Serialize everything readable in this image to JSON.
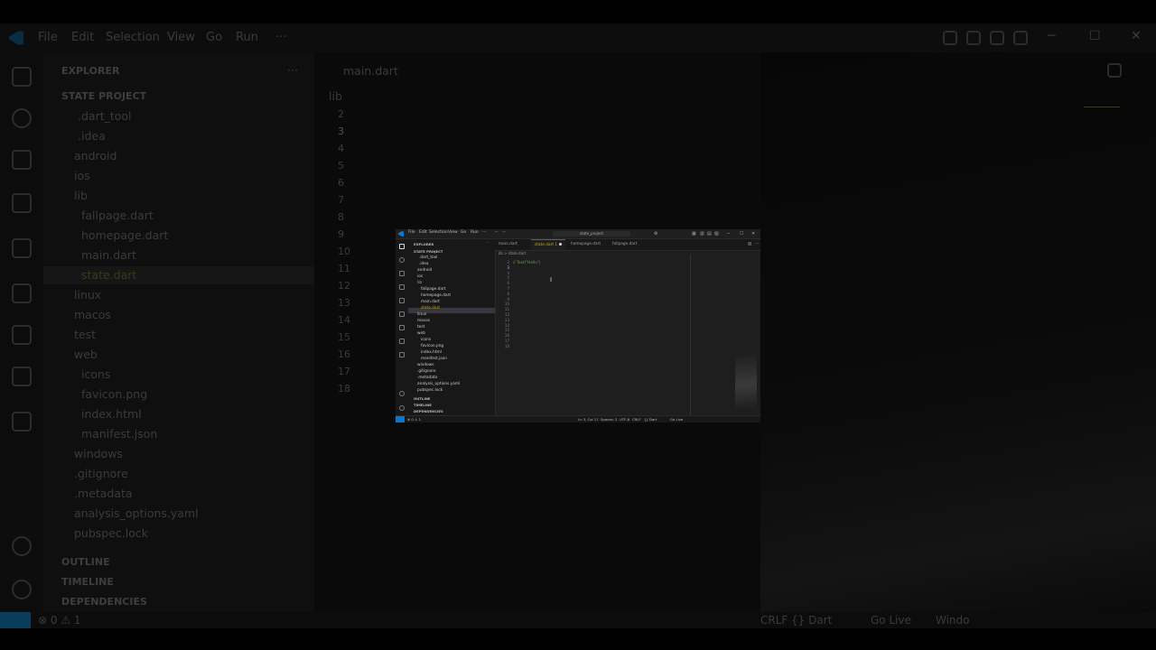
{
  "background": {
    "menu": [
      "File",
      "Edit",
      "Selection",
      "View",
      "Go",
      "Run",
      "···"
    ],
    "explorer_title": "EXPLORER",
    "project": "STATE PROJECT",
    "tree": [
      ".dart_tool",
      ".idea",
      "android",
      "ios",
      "lib",
      "fallpage.dart",
      "homepage.dart",
      "main.dart",
      "state.dart",
      "linux",
      "macos",
      "test",
      "web",
      "icons",
      "favicon.png",
      "index.html",
      "manifest.json",
      "windows",
      ".gitignore",
      ".metadata",
      "analysis_options.yaml",
      "pubspec.lock"
    ],
    "sections": [
      "OUTLINE",
      "TIMELINE",
      "DEPENDENCIES"
    ],
    "tab": "main.dart",
    "crumb": "lib",
    "line_numbers": [
      "2",
      "3",
      "4",
      "5",
      "6",
      "7",
      "8",
      "9",
      "10",
      "11",
      "12",
      "13",
      "14",
      "15",
      "16",
      "17",
      "18"
    ],
    "status_left": "⊗ 0 ⚠ 1",
    "status_right": [
      "CRLF",
      "{} Dart",
      "Go Live",
      "Windo"
    ]
  },
  "window": {
    "menu": [
      "File",
      "Edit",
      "Selection",
      "View",
      "Go",
      "Run",
      "···"
    ],
    "search": "state_project",
    "explorer_title": "EXPLORER",
    "project": "STATE PROJECT",
    "tree": [
      ".dart_tool",
      ".idea",
      "android",
      "ios",
      "lib",
      "fallpage.dart",
      "homepage.dart",
      "main.dart",
      "state.dart",
      "linux",
      "macos",
      "test",
      "web",
      "icons",
      "favicon.png",
      "index.html",
      "manifest.json",
      "windows",
      ".gitignore",
      ".metadata",
      "analysis_options.yaml",
      "pubspec.lock"
    ],
    "sections": [
      "OUTLINE",
      "TIMELINE",
      "DEPENDENCIES"
    ],
    "tabs": [
      "main.dart",
      "state.dart 1",
      "homepage.dart",
      "fallpage.dart"
    ],
    "crumb": "lib > state.dart",
    "line_numbers": [
      "2",
      "3",
      "4",
      "5",
      "6",
      "7",
      "8",
      "9",
      "10",
      "11",
      "12",
      "13",
      "14",
      "15",
      "16",
      "17",
      "18"
    ],
    "code_line": "// Text(\"Hello\")",
    "status_left": "⊗ 0 ⚠ 1",
    "status_right": [
      "Ln 3, Col 17",
      "Spaces: 2",
      "UTF-8",
      "CRLF",
      "{} Dart",
      "Go Live"
    ]
  },
  "colors": {
    "accent": "#0078d4",
    "background": "#000000",
    "editor": "#1e1e1e"
  }
}
